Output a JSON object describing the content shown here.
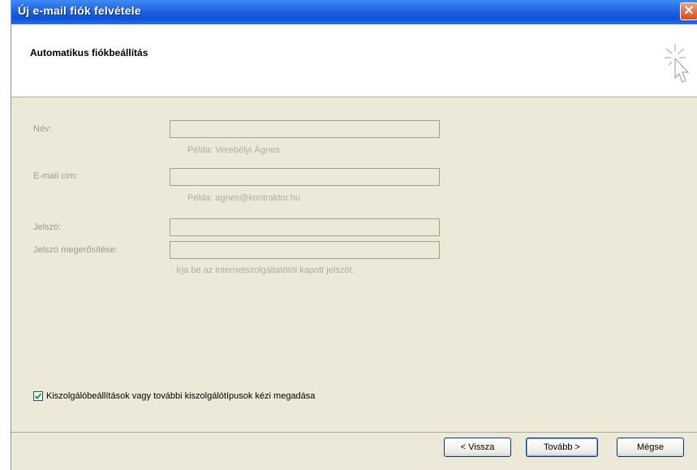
{
  "window": {
    "title": "Új e-mail fiók felvétele",
    "close_symbol": "✕"
  },
  "header": {
    "title": "Automatikus fiókbeállítás",
    "icon": "wizard-cursor-icon"
  },
  "form": {
    "name_label": "Név:",
    "name_value": "",
    "name_hint": "Példa: Verebélyi Ágnes",
    "email_label": "E-mail cím:",
    "email_value": "",
    "email_hint": "Példa: agnes@kontraktor.hu",
    "password_label": "Jelszó:",
    "password_value": "",
    "confirm_label": "Jelszó megerősítése:",
    "confirm_value": "",
    "password_hint": "Írja be az internetszolgáltatótól kapott jelszót."
  },
  "manual_setup": {
    "label": "Kiszolgálóbeállítások vagy további kiszolgálótípusok kézi megadása",
    "checked": true
  },
  "buttons": {
    "back": "< Vissza",
    "next": "Tovább >",
    "cancel": "Mégse"
  },
  "colors": {
    "titlebar": "#0b52d8",
    "dialog_bg": "#ece9d8",
    "disabled_text": "#9e9b8c"
  }
}
